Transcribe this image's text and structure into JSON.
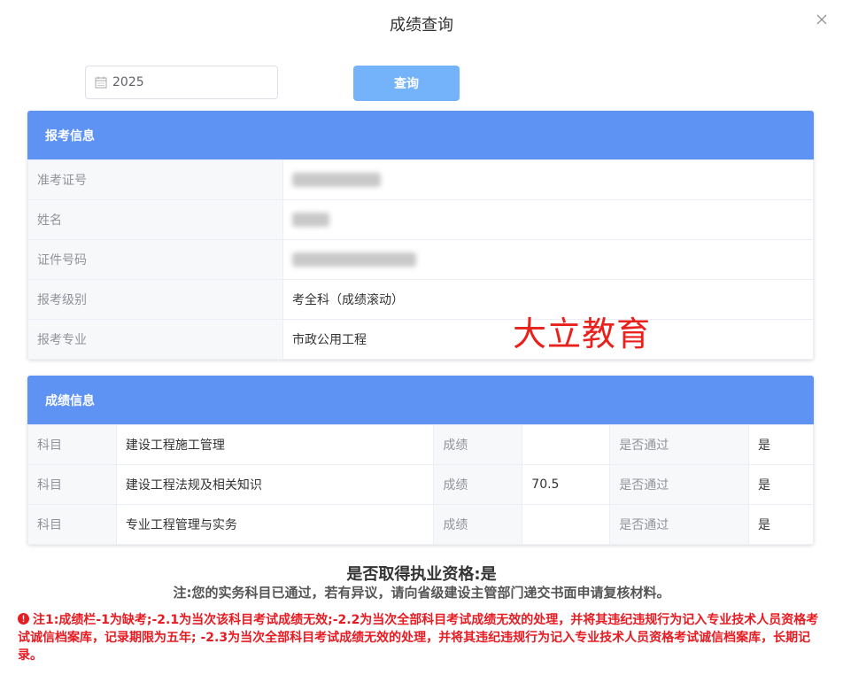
{
  "dialog": {
    "title": "成绩查询"
  },
  "search": {
    "year_value": "2025",
    "query_label": "查询"
  },
  "exam_info": {
    "header": "报考信息",
    "rows": [
      {
        "label": "准考证号",
        "value": "",
        "blurred": true
      },
      {
        "label": "姓名",
        "value": "",
        "blurred": true
      },
      {
        "label": "证件号码",
        "value": "",
        "blurred": true
      },
      {
        "label": "报考级别",
        "value": "考全科（成绩滚动）"
      },
      {
        "label": "报考专业",
        "value": "市政公用工程"
      }
    ]
  },
  "watermark": "大立教育",
  "score_info": {
    "header": "成绩信息",
    "subject_label": "科目",
    "score_label": "成绩",
    "pass_label": "是否通过",
    "rows": [
      {
        "subject": "建设工程施工管理",
        "score": "",
        "pass": "是"
      },
      {
        "subject": "建设工程法规及相关知识",
        "score": "70.5",
        "pass": "是"
      },
      {
        "subject": "专业工程管理与实务",
        "score": "",
        "pass": "是"
      }
    ]
  },
  "qualification": "是否取得执业资格:是",
  "note": "注:您的实务科目已通过，若有异议，请向省级建设主管部门递交书面申请复核材料。",
  "footnote": "注1:成绩栏-1为缺考;-2.1为当次该科目考试成绩无效;-2.2为当次全部科目考试成绩无效的处理，并将其违纪违规行为记入专业技术人员资格考试诚信档案库，记录期限为五年; -2.3为当次全部科目考试成绩无效的处理，并将其违纪违规行为记入专业技术人员资格考试诚信档案库，长期记录。",
  "colors": {
    "header_blue": "#5e92f3",
    "button_blue": "#74b3fa",
    "alert_red": "#e51c23"
  }
}
